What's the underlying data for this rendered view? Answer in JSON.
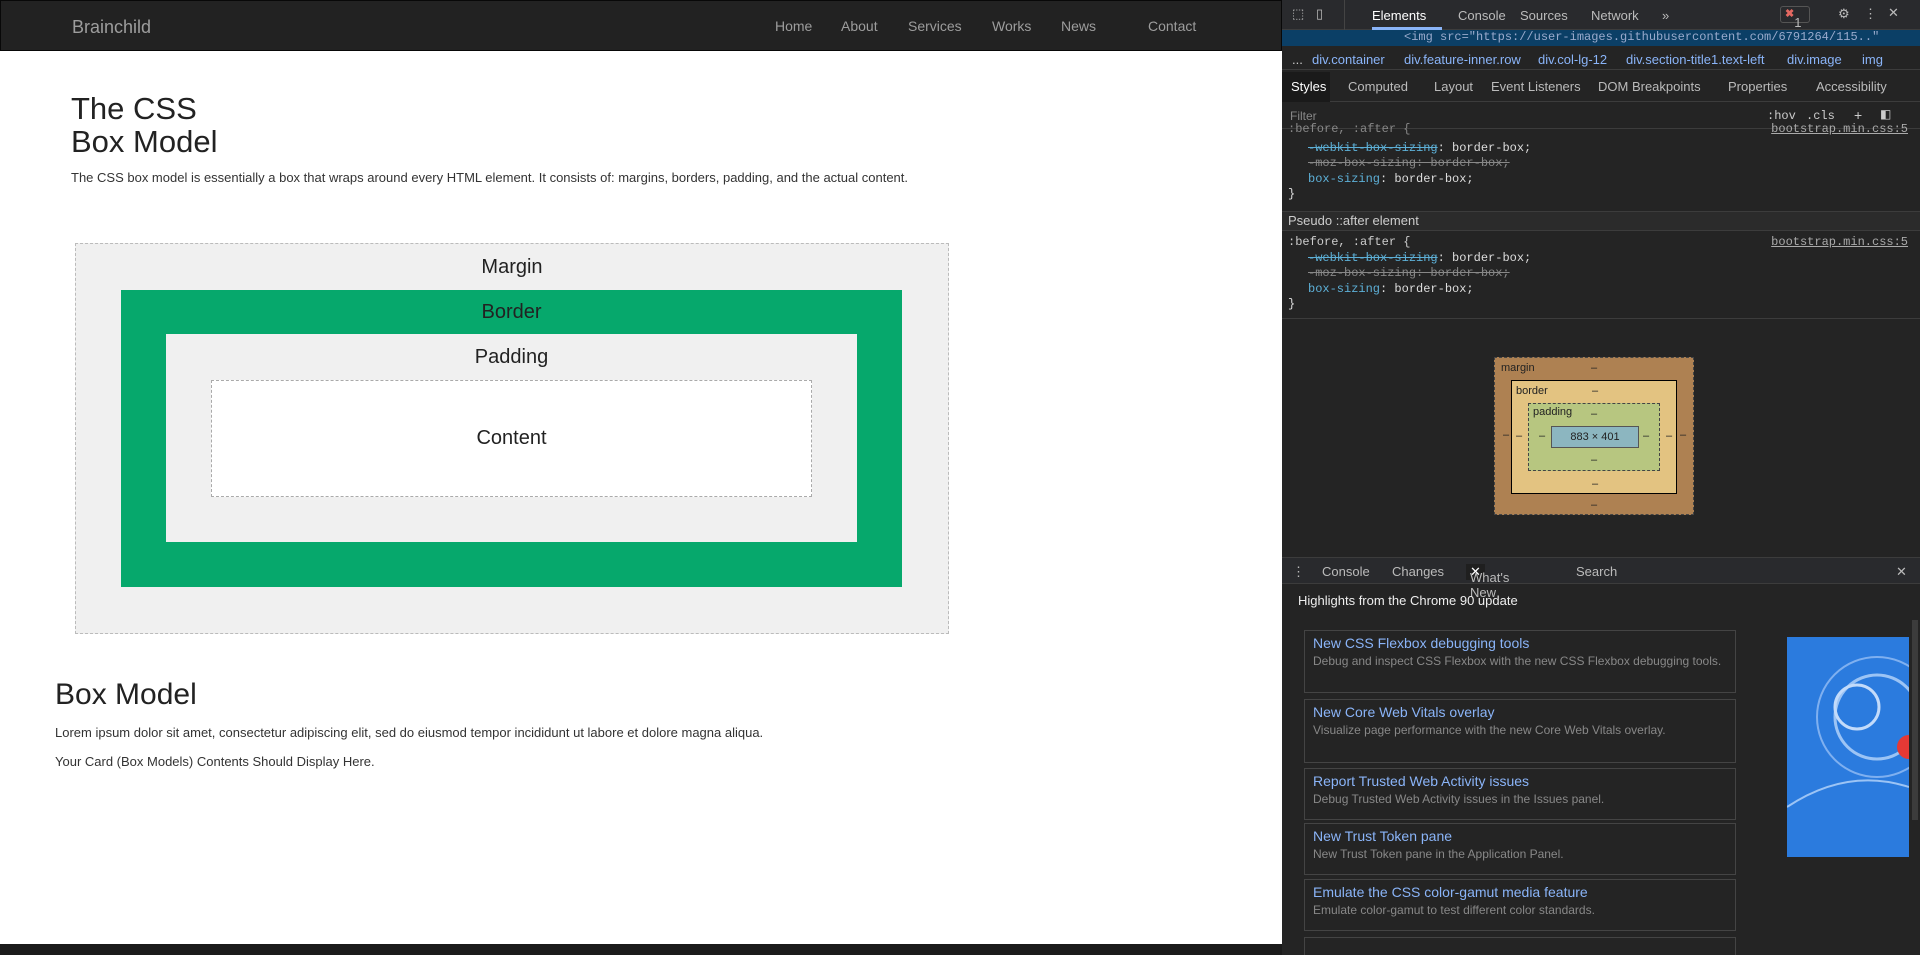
{
  "site": {
    "brand": "Brainchild",
    "nav": [
      "Home",
      "About",
      "Services",
      "Works",
      "News",
      "Contact"
    ],
    "title_line1": "The CSS",
    "title_line2": "Box Model",
    "intro": "The CSS box model is essentially a box that wraps around every HTML element. It consists of: margins, borders, padding, and the actual content.",
    "diagram": {
      "margin": "Margin",
      "border": "Border",
      "padding": "Padding",
      "content": "Content"
    },
    "section_title": "Box Model",
    "para1": "Lorem ipsum dolor sit amet, consectetur adipiscing elit, sed do eiusmod tempor incididunt ut labore et dolore magna aliqua.",
    "para2": "Your Card (Box Models) Contents Should Display Here."
  },
  "devtools": {
    "tabs": [
      "Elements",
      "Console",
      "Sources",
      "Network"
    ],
    "more": "»",
    "error_count": "1",
    "code_line": "<img src=\"https://user-images.githubusercontent.com/6791264/115..\"",
    "breadcrumbs": [
      "...",
      "div.container",
      "div.feature-inner.row",
      "div.col-lg-12",
      "div.section-title1.text-left",
      "div.image",
      "img"
    ],
    "subtabs": [
      "Styles",
      "Computed",
      "Layout",
      "Event Listeners",
      "DOM Breakpoints",
      "Properties",
      "Accessibility"
    ],
    "filter_placeholder": "Filter",
    "hov": ":hov",
    "cls": ".cls",
    "rule1": {
      "selector": ":before, :after {",
      "source": "bootstrap.min.css:5",
      "webkit": "-webkit-box-sizing",
      "moz": "-moz-box-sizing: border-box;",
      "prop": "box-sizing",
      "value": "border-box;"
    },
    "pseudo_label": "Pseudo ::after element",
    "rule2": {
      "selector": ":before, :after {",
      "source": "bootstrap.min.css:5",
      "webkit": "-webkit-box-sizing",
      "moz": "-moz-box-sizing: border-box;",
      "prop": "box-sizing",
      "value": "border-box;"
    },
    "boxmodel": {
      "margin": "margin",
      "border": "border",
      "padding": "padding",
      "content": "883 × 401",
      "dash": "–"
    },
    "drawer_tabs": [
      "Console",
      "Changes",
      "What's New",
      "Search"
    ],
    "highlights": "Highlights from the Chrome 90 update",
    "cards": [
      {
        "title": "New CSS Flexbox debugging tools",
        "desc": "Debug and inspect CSS Flexbox with the new CSS Flexbox debugging tools."
      },
      {
        "title": "New Core Web Vitals overlay",
        "desc": "Visualize page performance with the new Core Web Vitals overlay."
      },
      {
        "title": "Report Trusted Web Activity issues",
        "desc": "Debug Trusted Web Activity issues in the Issues panel."
      },
      {
        "title": "New Trust Token pane",
        "desc": "New Trust Token pane in the Application Panel."
      },
      {
        "title": "Emulate the CSS color-gamut media feature",
        "desc": "Emulate color-gamut to test different color standards."
      }
    ]
  }
}
